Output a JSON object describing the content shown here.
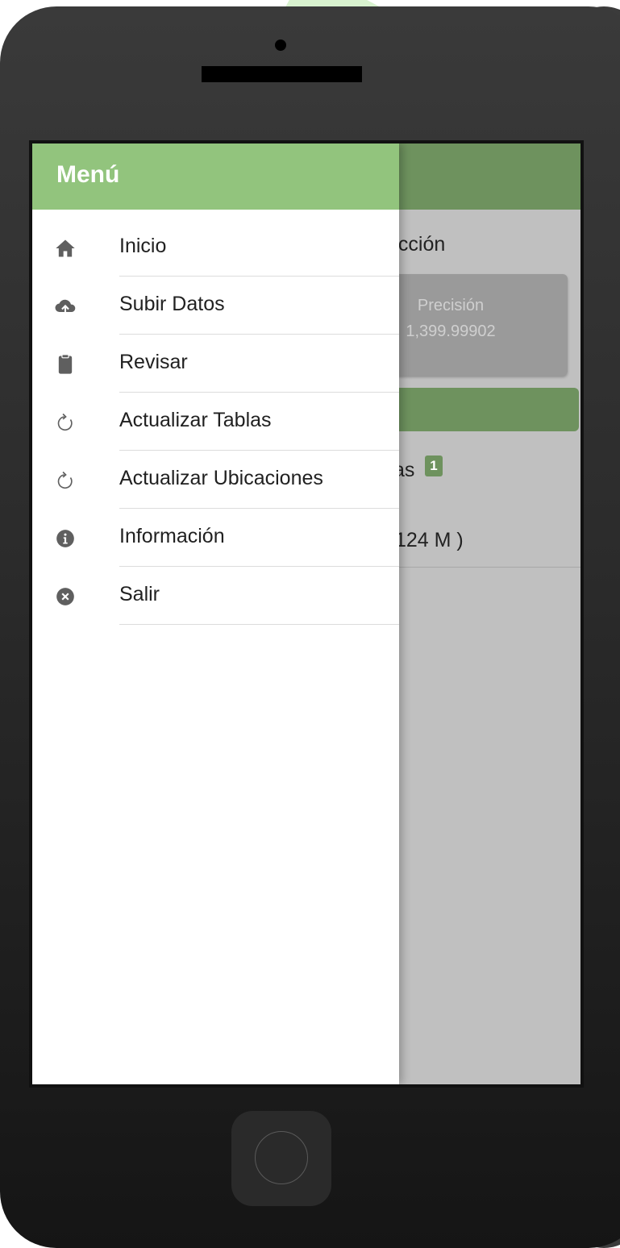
{
  "drawer": {
    "title": "Menú",
    "items": [
      {
        "label": "Inicio",
        "icon": "home-icon"
      },
      {
        "label": "Subir Datos",
        "icon": "cloud-upload-icon"
      },
      {
        "label": "Revisar",
        "icon": "clipboard-icon"
      },
      {
        "label": "Actualizar Tablas",
        "icon": "refresh-icon"
      },
      {
        "label": "Actualizar Ubicaciones",
        "icon": "refresh-icon"
      },
      {
        "label": "Información",
        "icon": "info-icon"
      },
      {
        "label": "Salir",
        "icon": "close-circle-icon"
      }
    ]
  },
  "background": {
    "heading_fragment": "ección",
    "card_label": "Precisión",
    "card_value": "1,399.99902",
    "list_fragment": "as",
    "badge_count": "1",
    "distance_fragment": "124 M )"
  },
  "colors": {
    "header_green": "#92c47d",
    "dimmed_green": "#6e925e",
    "overlay_gray": "#c0c0c0"
  }
}
